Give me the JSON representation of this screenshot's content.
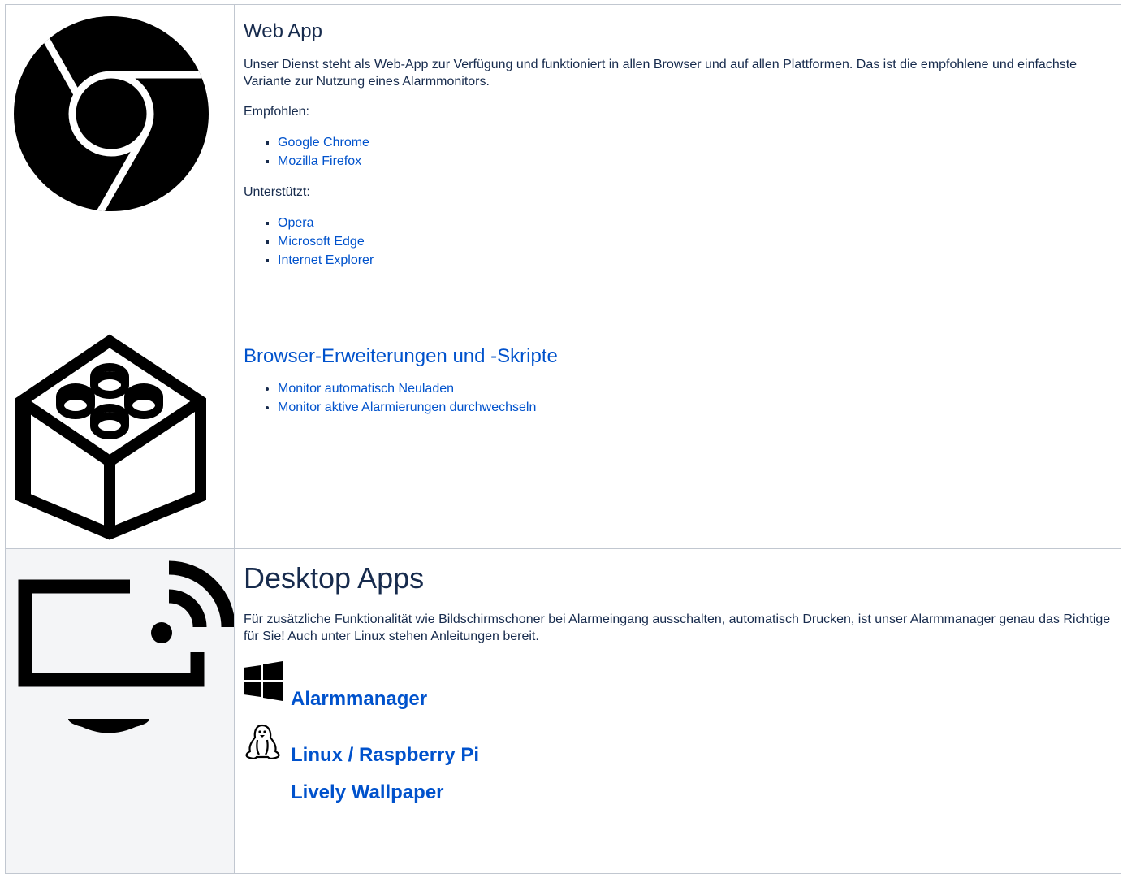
{
  "web_app": {
    "icon": "chrome-icon",
    "title": "Web App",
    "description": "Unser Dienst steht als Web-App zur Verfügung und funktioniert in allen Browser und auf allen Plattformen. Das ist die empfohlene und einfachste Variante zur Nutzung eines Alarmmonitors.",
    "recommended_label": "Empfohlen:",
    "recommended": [
      "Google Chrome",
      "Mozilla Firefox"
    ],
    "supported_label": "Unterstützt:",
    "supported": [
      "Opera",
      "Microsoft Edge",
      "Internet Explorer"
    ]
  },
  "extensions": {
    "icon": "building-block-icon",
    "title": "Browser-Erweiterungen und -Skripte",
    "items": [
      "Monitor automatisch Neuladen",
      "Monitor aktive Alarmierungen durchwechseln"
    ]
  },
  "desktop": {
    "icon": "cast-monitor-icon",
    "title": "Desktop Apps",
    "description": "Für zusätzliche Funktionalität wie Bildschirmschoner bei Alarmeingang ausschalten, automatisch Drucken, ist unser Alarmmanager genau das Richtige für Sie! Auch unter Linux stehen Anleitungen bereit.",
    "links": [
      {
        "label": "Alarmmanager",
        "icon": "windows-icon"
      },
      {
        "label": "Linux / Raspberry Pi",
        "icon": "linux-penguin-icon"
      },
      {
        "label": "Lively Wallpaper",
        "icon": ""
      }
    ]
  }
}
